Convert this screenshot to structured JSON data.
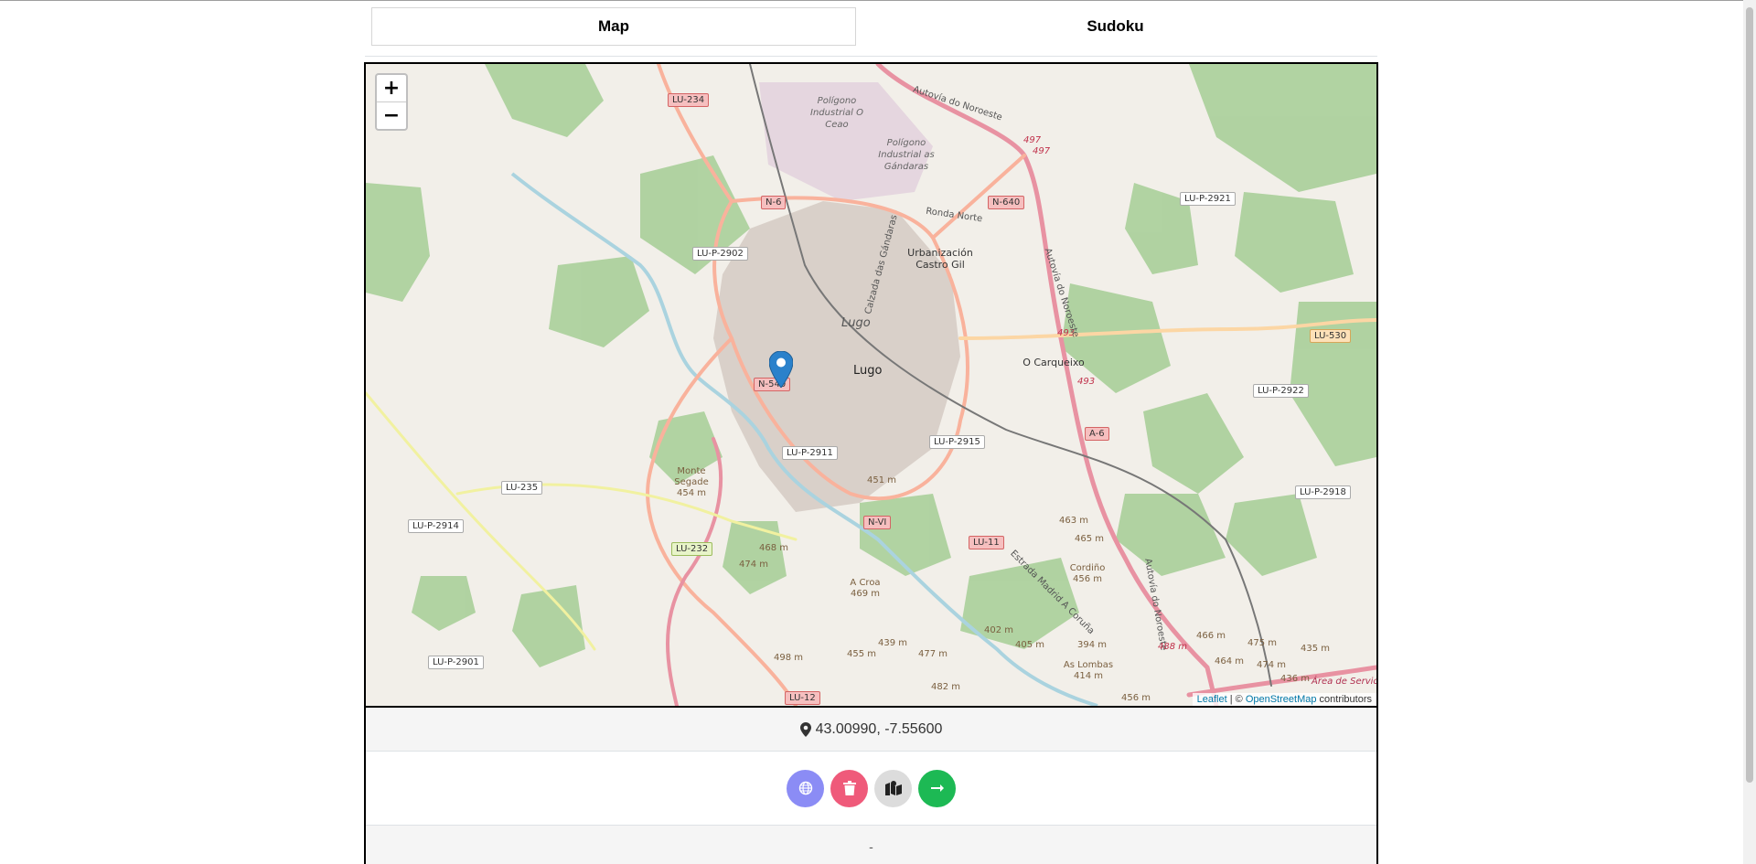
{
  "tabs": [
    {
      "label": "Map",
      "active": true
    },
    {
      "label": "Sudoku",
      "active": false
    }
  ],
  "map": {
    "zoom_in": "+",
    "zoom_out": "−",
    "attribution": {
      "leaflet": "Leaflet",
      "separator": " | © ",
      "osm": "OpenStreetMap",
      "suffix": " contributors"
    },
    "cities": [
      "Lugo",
      "Lugo"
    ],
    "places": [
      "Polígono Industrial O Ceao",
      "Polígono Industrial as Gándaras",
      "Urbanización Castro Gil",
      "O Carqueixo",
      "Monte Segade 454 m",
      "A Croa 469 m",
      "Cordiño 456 m",
      "As Lombas 414 m",
      "Área de Servicio"
    ],
    "roads": [
      "LU-234",
      "N-6",
      "N-640",
      "LU-P-2902",
      "LU-P-2921",
      "LU-530",
      "N-540",
      "LU-P-2922",
      "LU-P-2911",
      "LU-P-2915",
      "LU-235",
      "LU-P-2914",
      "LU-P-2918",
      "N-VI",
      "LU-11",
      "LU-232",
      "LU-P-2901",
      "LU-12",
      "A-6"
    ],
    "road_refs": [
      "497",
      "497",
      "493",
      "493"
    ],
    "street_labels": [
      "Autovía do Noroeste",
      "Ronda Norte",
      "Calzada das Gándaras",
      "Autovía do Noroeste",
      "Estrada Madrid A Coruña",
      "Autovía do Noroeste"
    ],
    "elevations": [
      "451 m",
      "463 m",
      "465 m",
      "468 m",
      "474 m",
      "402 m",
      "405 m",
      "394 m",
      "439 m",
      "477 m",
      "455 m",
      "498 m",
      "482 m",
      "466 m",
      "475 m",
      "474 m",
      "435 m",
      "436 m",
      "456 m",
      "488 m",
      "464 m"
    ]
  },
  "location": {
    "icon": "map-marker-icon",
    "coordinates": "43.00990, -7.55600"
  },
  "actions": [
    {
      "name": "globe-button",
      "icon": "globe-icon",
      "color": "#8b8cf5"
    },
    {
      "name": "delete-button",
      "icon": "trash-icon",
      "color": "#ef5a7a"
    },
    {
      "name": "map-button",
      "icon": "map-icon",
      "color": "#dcdcdc"
    },
    {
      "name": "next-button",
      "icon": "arrow-right-icon",
      "color": "#1db954"
    }
  ],
  "footer": {
    "text": "-"
  },
  "colors": {
    "green_area": "#add19e",
    "urban": "#d9d0c9",
    "motorway": "#e892a2",
    "primary": "#fcd6a4",
    "trunk": "#f9b29c"
  }
}
